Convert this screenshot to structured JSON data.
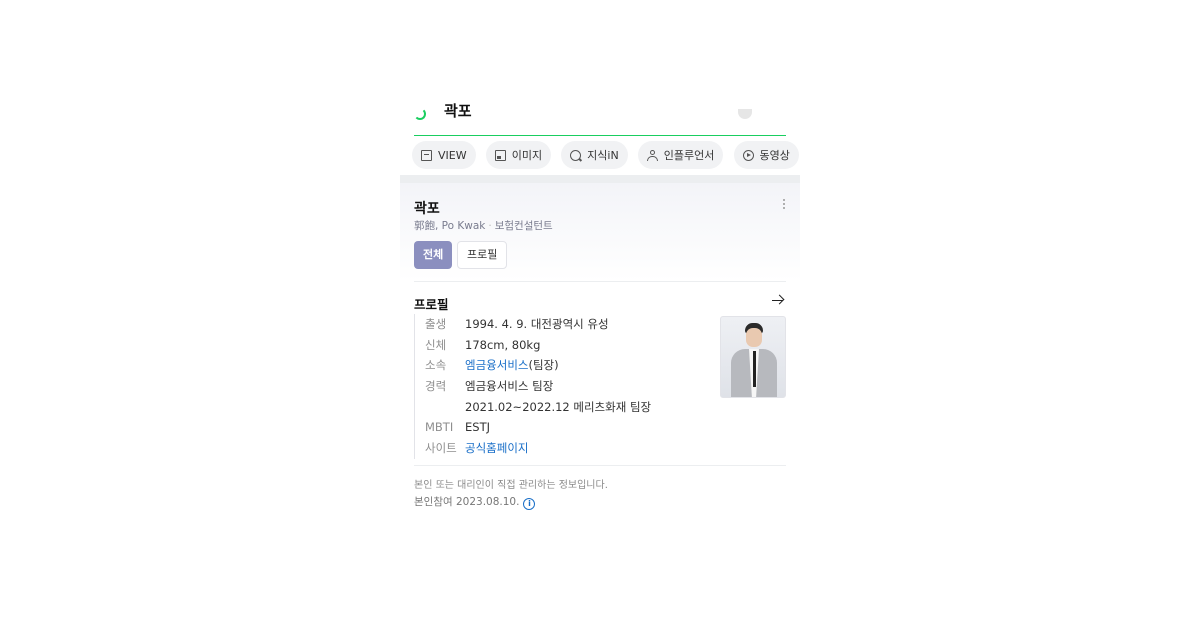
{
  "search": {
    "query": "곽포"
  },
  "tabs": [
    {
      "label": "VIEW",
      "icon": "document-icon"
    },
    {
      "label": "이미지",
      "icon": "image-icon"
    },
    {
      "label": "지식iN",
      "icon": "question-icon"
    },
    {
      "label": "인플루언서",
      "icon": "person-icon"
    },
    {
      "label": "동영상",
      "icon": "play-icon"
    },
    {
      "label": "",
      "icon": "shopping-icon"
    }
  ],
  "profile": {
    "name": "곽포",
    "alias": "郭飽, Po Kwak",
    "occupation": "보험컨설턴트",
    "chips": {
      "all": "전체",
      "profile": "프로필"
    },
    "section_title": "프로필",
    "rows": [
      {
        "label": "출생",
        "value": "1994. 4. 9. 대전광역시 유성"
      },
      {
        "label": "신체",
        "value": "178cm, 80kg"
      },
      {
        "label": "소속",
        "link": "엠금융서비스",
        "value": "(팀장)"
      },
      {
        "label": "경력",
        "value": "엠금융서비스 팀장"
      },
      {
        "label": "",
        "value": "2021.02~2022.12 메리츠화재 팀장"
      },
      {
        "label": "MBTI",
        "value": "ESTJ"
      },
      {
        "label": "사이트",
        "link": "공식홈페이지"
      }
    ],
    "footer_note": "본인 또는 대리인이 직접 관리하는 정보입니다.",
    "footer_date": "본인참여 2023.08.10."
  },
  "colors": {
    "accent_green": "#19ce60",
    "chip_active": "#8b8fbf",
    "link": "#1a6fc8"
  }
}
